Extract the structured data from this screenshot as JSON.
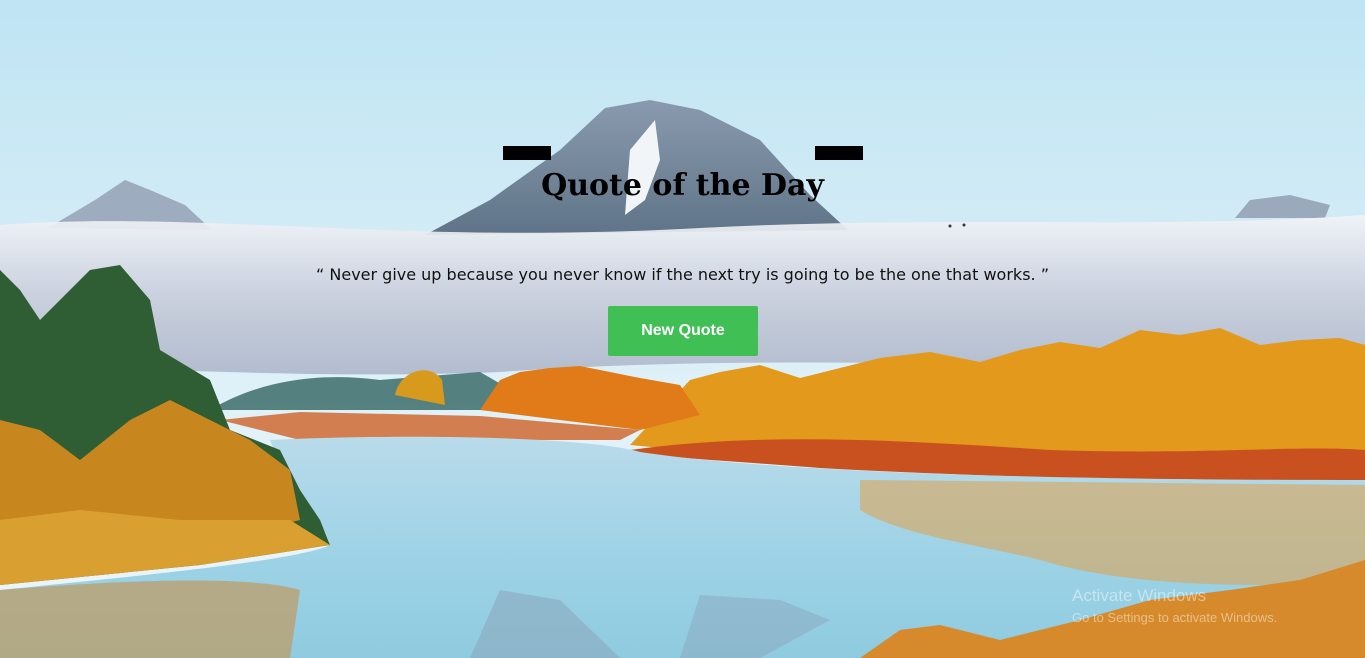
{
  "page": {
    "title": "Quote of the Day",
    "quote_text": "“ Never give up because you never know if the next try is going to be the one that works. ”",
    "button_label": "New Quote"
  },
  "watermark": {
    "line1": "Activate Windows",
    "line2": "Go to Settings to activate Windows."
  },
  "colors": {
    "button_bg": "#3fbf54",
    "title": "#000000",
    "deco_bars": "#000000"
  },
  "background": {
    "icon": "landscape-photo"
  }
}
